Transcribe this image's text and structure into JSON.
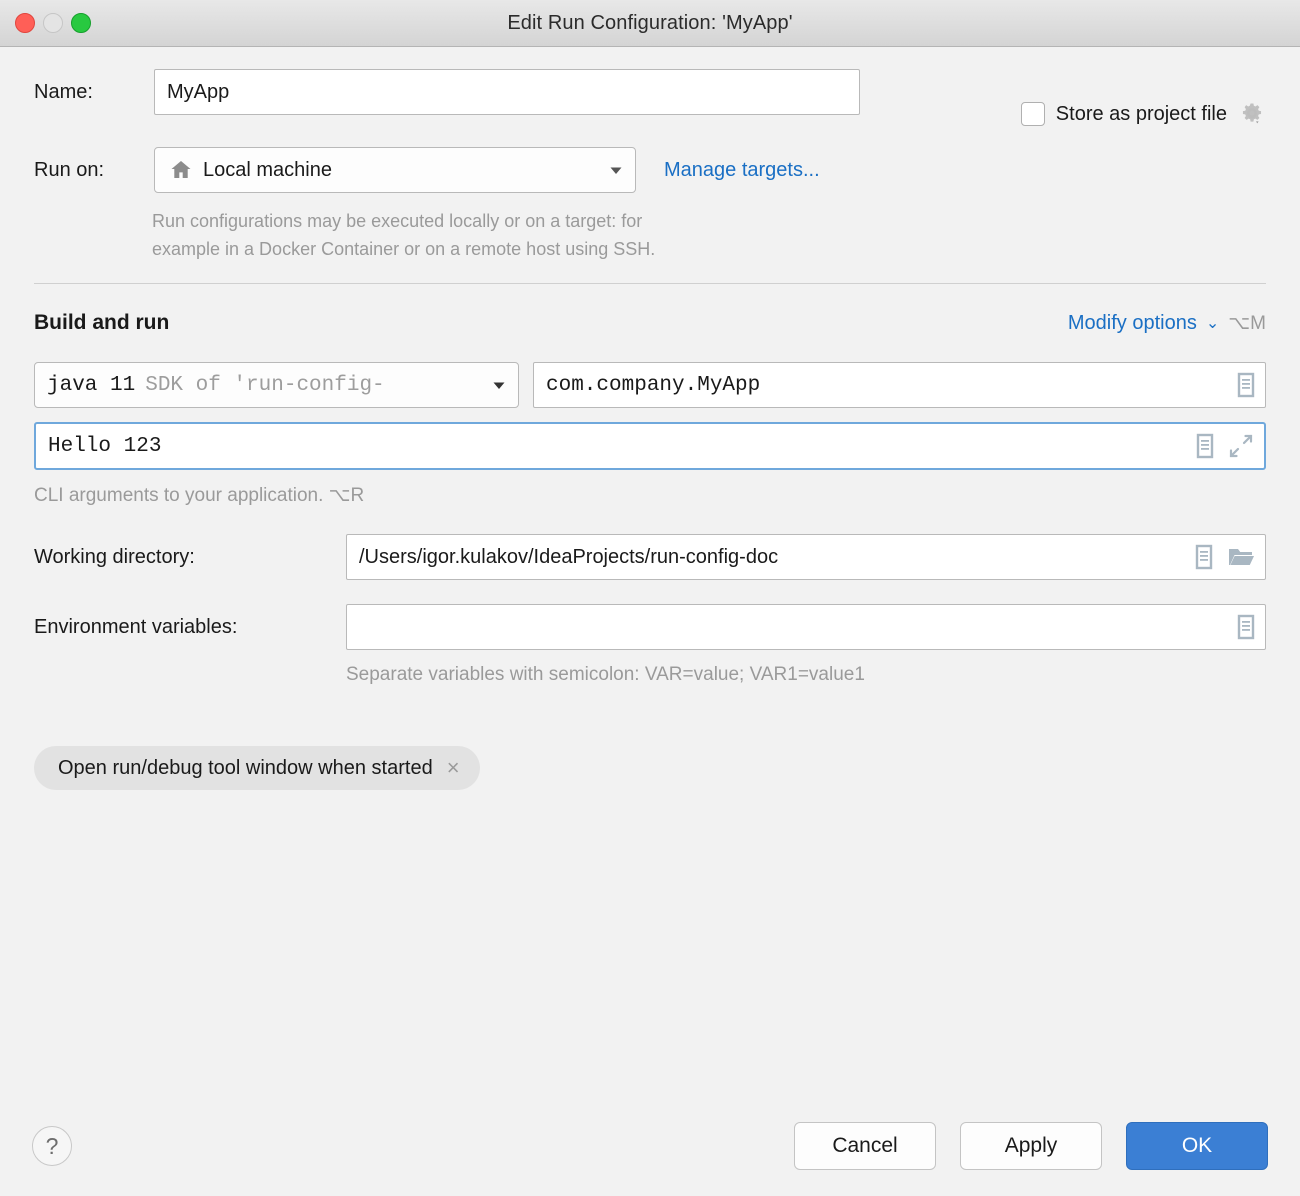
{
  "window": {
    "title": "Edit Run Configuration: 'MyApp'",
    "traffic_lights": [
      "close-button",
      "minimize-button",
      "zoom-button"
    ]
  },
  "form": {
    "name_label": "Name:",
    "name_value": "MyApp",
    "store_as_project_file_label": "Store as project file",
    "store_as_project_file_checked": false,
    "gear_icon": "gear-icon",
    "run_on_label": "Run on:",
    "run_on_value": "Local machine",
    "run_on_icon": "home-icon",
    "manage_targets_label": "Manage targets...",
    "targets_hint_line1": "Run configurations may be executed locally or on a target: for",
    "targets_hint_line2": "example in a Docker Container or on a remote host using SSH."
  },
  "build_and_run": {
    "section_title": "Build and run",
    "modify_options_label": "Modify options",
    "modify_options_shortcut": "⌥M",
    "sdk_main": "java 11",
    "sdk_sub": "SDK of 'run-config-",
    "main_class_value": "com.company.MyApp",
    "program_arguments_value": "Hello 123",
    "program_arguments_focused": true,
    "cli_hint": "CLI arguments to your application. ⌥R",
    "working_directory_label": "Working directory:",
    "working_directory_value": "/Users/igor.kulakov/IdeaProjects/run-config-doc",
    "environment_variables_label": "Environment variables:",
    "environment_variables_value": "",
    "environment_variables_hint": "Separate variables with semicolon: VAR=value; VAR1=value1"
  },
  "options_chips": [
    {
      "label": "Open run/debug tool window when started",
      "remove_icon": "×"
    }
  ],
  "footer": {
    "help_label": "?",
    "cancel_label": "Cancel",
    "apply_label": "Apply",
    "ok_label": "OK"
  },
  "colors": {
    "accent_blue": "#3b7fd4",
    "link_blue": "#1a6fc4",
    "focus_border": "#6fa8dc",
    "background": "#f2f2f2",
    "hint_gray": "#9a9a9a"
  }
}
